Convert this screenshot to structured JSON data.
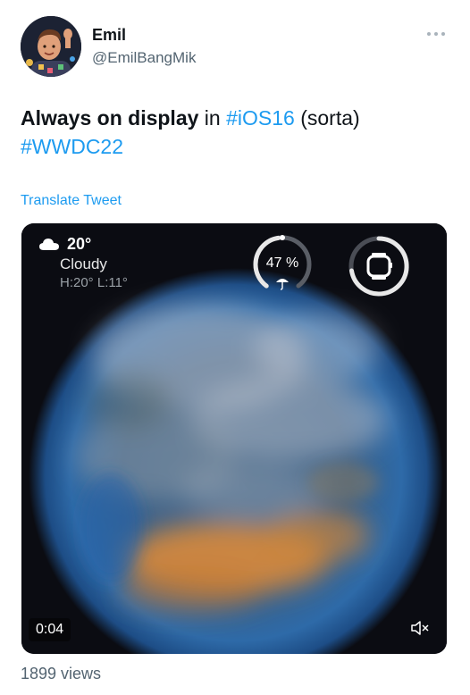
{
  "author": {
    "name": "Emil",
    "handle": "@EmilBangMik",
    "avatar_icon": "memoji-avatar-icon"
  },
  "more_menu_icon": "more-dots-icon",
  "tweet": {
    "text_bold": "Always on display",
    "text_in": " in ",
    "hashtag_1": "#iOS16",
    "text_paren": " (sorta)",
    "hashtag_2": "#WWDC22",
    "translate_label": "Translate Tweet"
  },
  "media": {
    "weather": {
      "icon": "cloud-icon",
      "temperature": "20°",
      "condition": "Cloudy",
      "high_low": "H:20° L:11°"
    },
    "umbrella_gauge": {
      "label": "47 %",
      "value_percent": 47,
      "icon": "umbrella-icon"
    },
    "watch_gauge": {
      "icon": "apple-watch-icon"
    },
    "timestamp": "0:04",
    "mute_icon": "muted-speaker-icon"
  },
  "stats": {
    "views": "1899 views"
  },
  "colors": {
    "link": "#1d9bf0",
    "secondary_text": "#536471",
    "primary_text": "#0f1419"
  }
}
